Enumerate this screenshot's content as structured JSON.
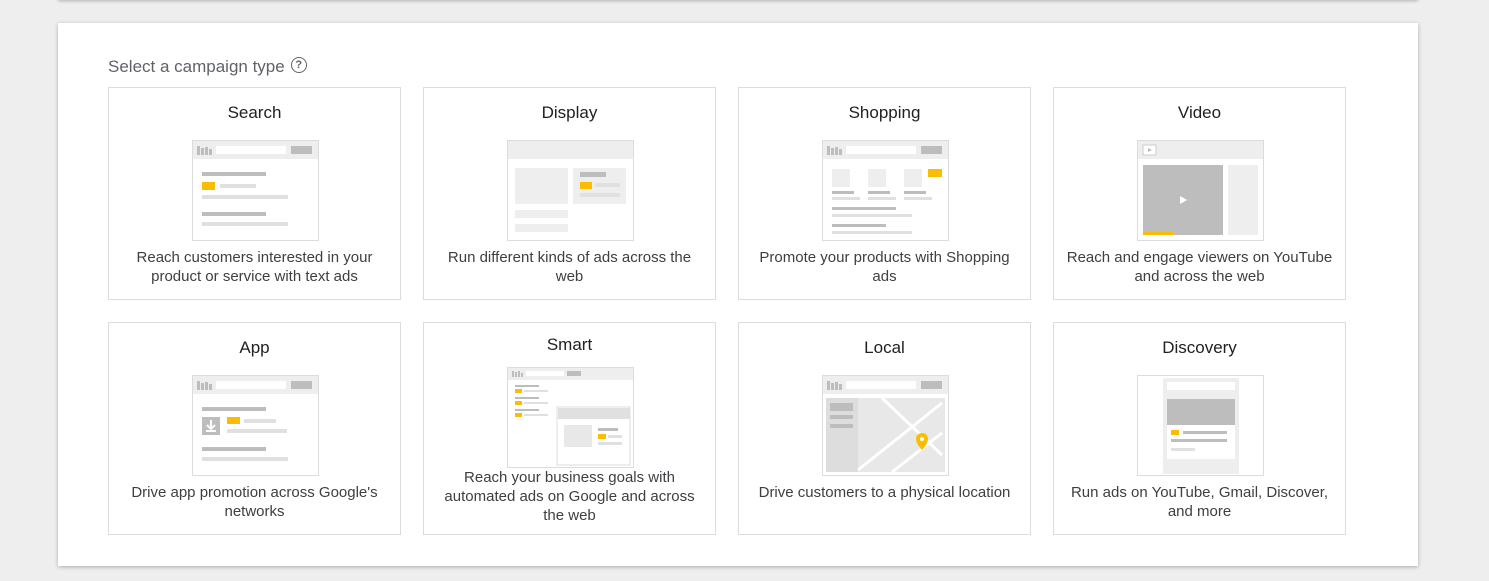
{
  "heading": {
    "label": "Select a campaign type",
    "help_glyph": "?"
  },
  "cards": [
    {
      "title": "Search",
      "description": "Reach customers interested in your product or service with text ads"
    },
    {
      "title": "Display",
      "description": "Run different kinds of ads across the web"
    },
    {
      "title": "Shopping",
      "description": "Promote your products with Shopping ads"
    },
    {
      "title": "Video",
      "description": "Reach and engage viewers on YouTube and across the web"
    },
    {
      "title": "App",
      "description": "Drive app promotion across Google's networks"
    },
    {
      "title": "Smart",
      "description": "Reach your business goals with automated ads on Google and across the web"
    },
    {
      "title": "Local",
      "description": "Drive customers to a physical location"
    },
    {
      "title": "Discovery",
      "description": "Run ads on YouTube, Gmail, Discover, and more"
    }
  ],
  "colors": {
    "accent": "#fbbc04",
    "illustration_gray": "#bdbdbd",
    "illustration_light": "#e8e8e8",
    "border": "#dadce0"
  }
}
